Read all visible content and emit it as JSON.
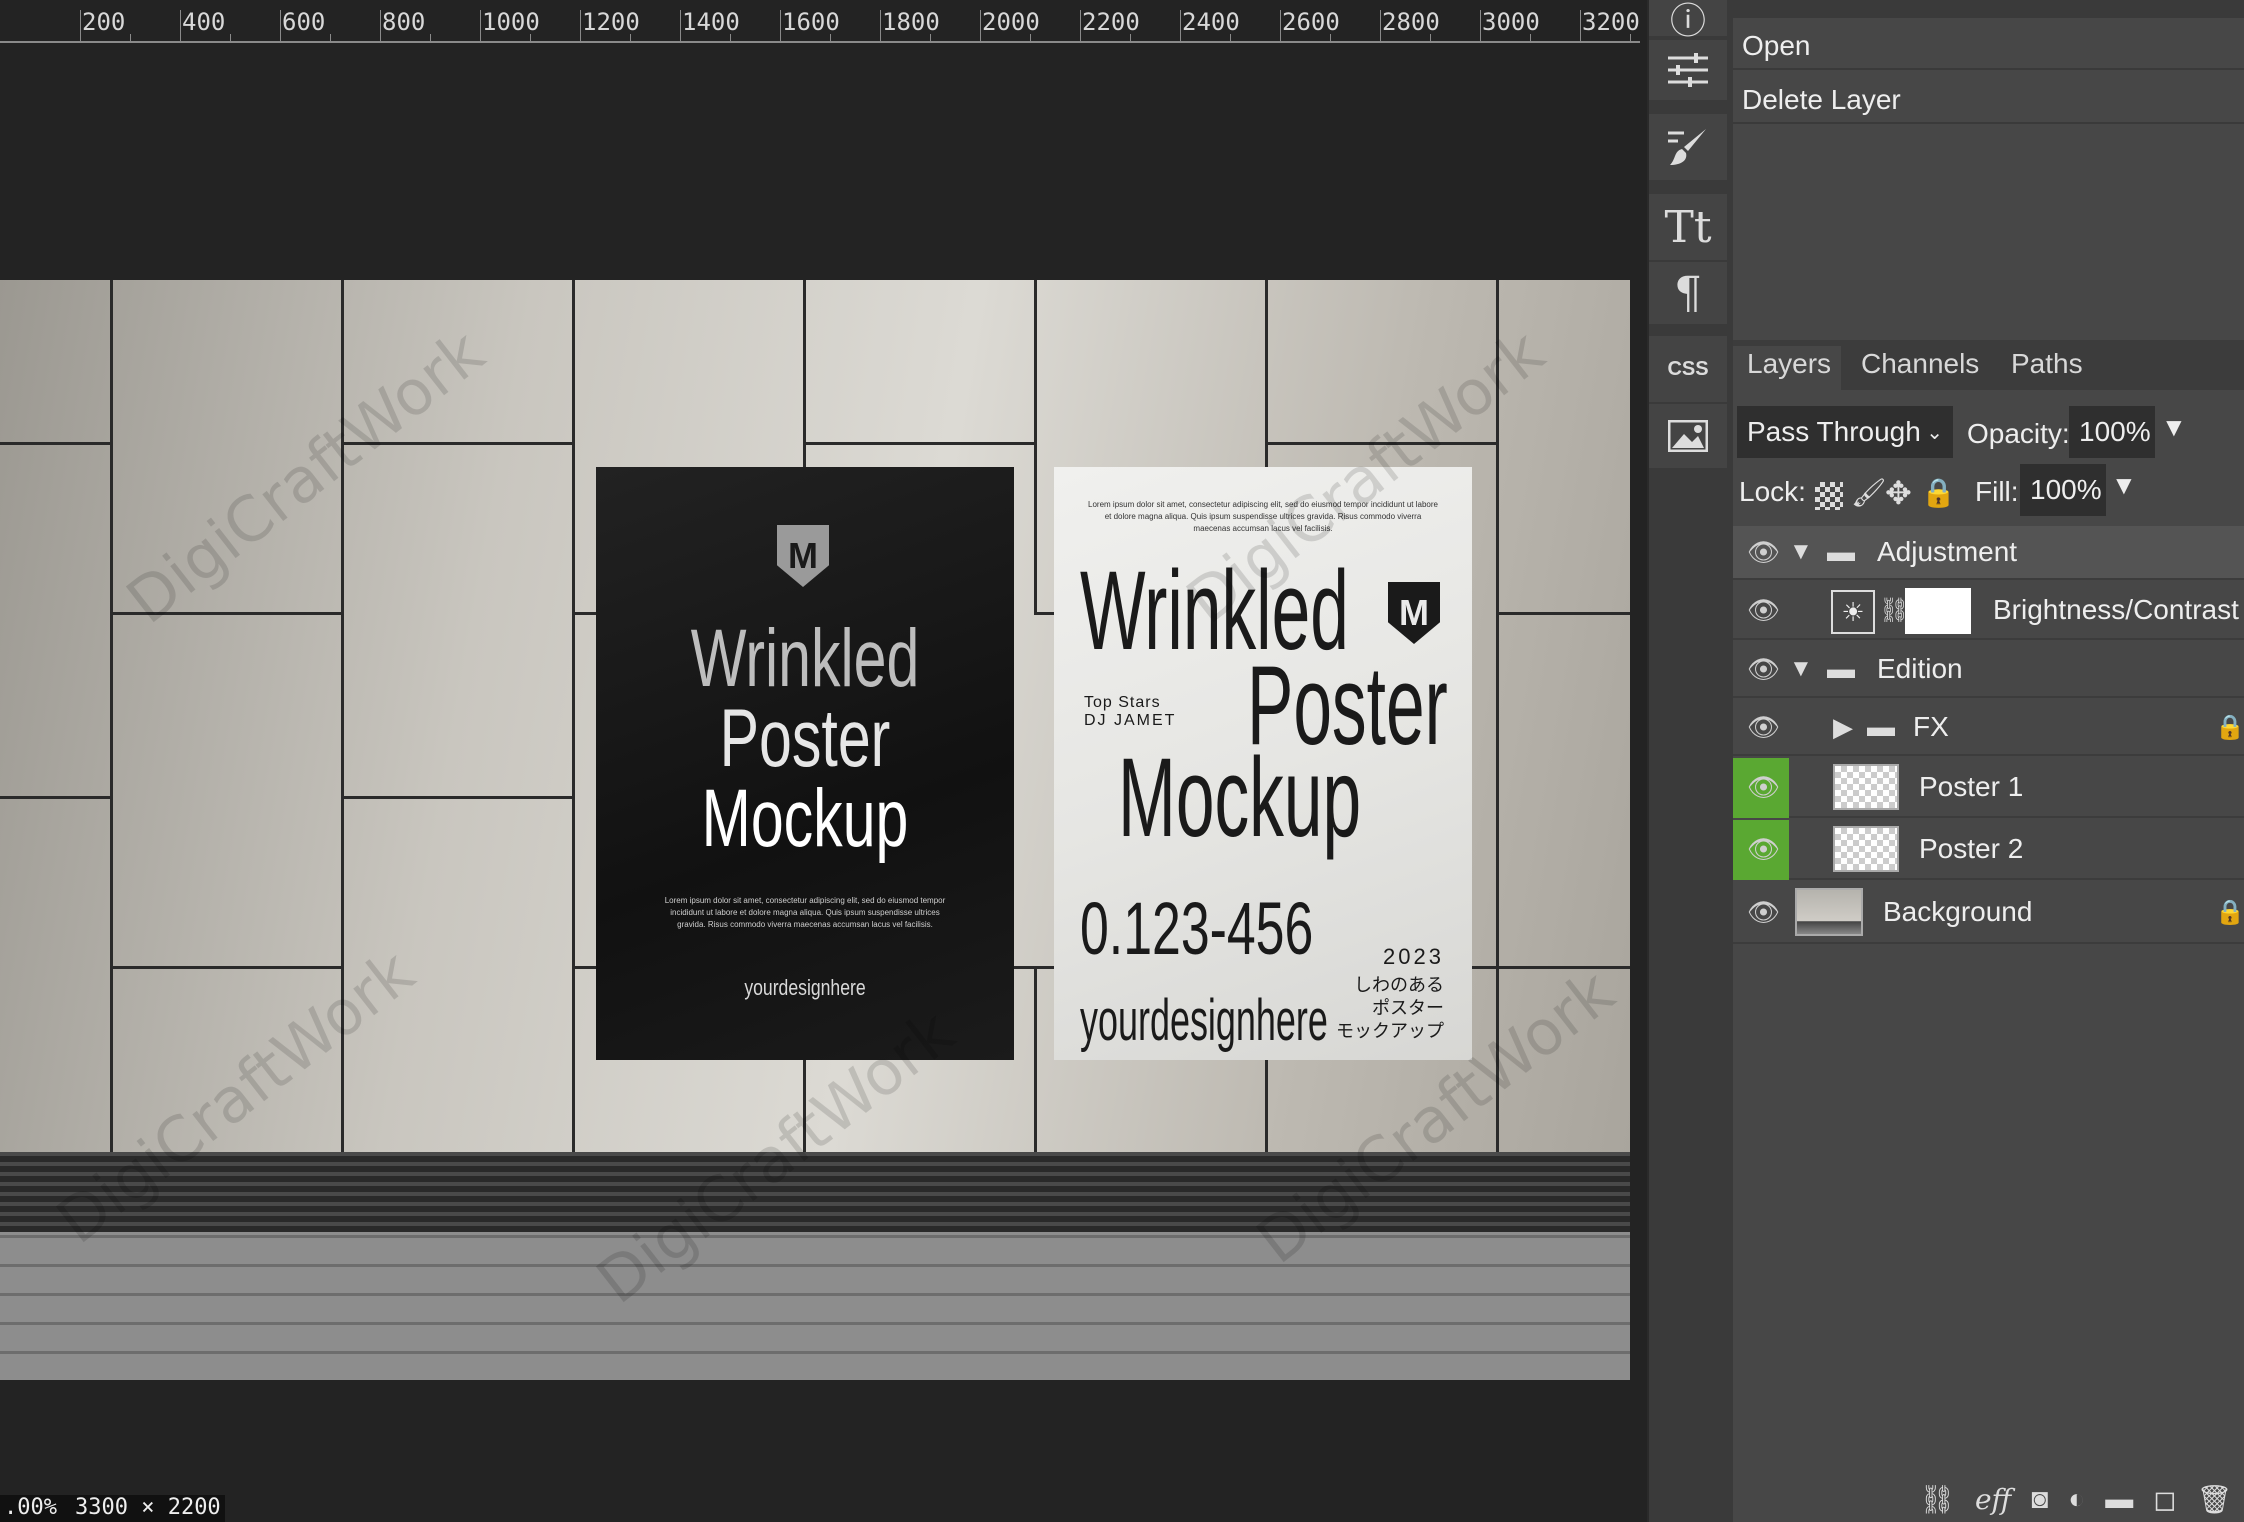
{
  "ruler": {
    "labels": [
      "200",
      "400",
      "600",
      "800",
      "1000",
      "1200",
      "1400",
      "1600",
      "1800",
      "2000",
      "2200",
      "2400",
      "2600",
      "2800",
      "3000",
      "3200"
    ]
  },
  "watermark": "DigiCraftWork",
  "poster1": {
    "title_l1": "Wrinkled",
    "title_l2": "Poster",
    "title_l3": "Mockup",
    "lorem": "Lorem ipsum dolor sit amet, consectetur adipiscing elit, sed do eiusmod tempor incididunt ut labore et dolore magna aliqua. Quis ipsum suspendisse ultrices gravida. Risus commodo viverra maecenas accumsan lacus vel facilisis.",
    "site": "yourdesignhere",
    "logo": "M"
  },
  "poster2": {
    "lorem": "Lorem ipsum dolor sit amet, consectetur adipiscing elit, sed do eiusmod tempor incididunt ut labore et dolore magna aliqua. Quis ipsum suspendisse ultrices gravida. Risus commodo viverra maecenas accumsan lacus vel facilisis.",
    "title_l1": "Wrinkled",
    "title_l2": "Poster",
    "title_l3": "Mockup",
    "top_stars": "Top Stars",
    "dj": "DJ JAMET",
    "phone": "0.123-456",
    "year": "2023",
    "jp1": "しわのある",
    "jp2": "ポスター",
    "jp3": "モックアップ",
    "site": "yourdesignhere",
    "logo": "M"
  },
  "toolbar": {
    "icons": [
      "info-icon",
      "adjustments-icon",
      "brush-icon",
      "text-icon",
      "paragraph-icon",
      "css-icon",
      "image-icon"
    ],
    "text_glyph": "Tt",
    "para_glyph": "¶",
    "css_label": "CSS"
  },
  "history": {
    "items": [
      "Open",
      "Delete Layer"
    ]
  },
  "layers_panel": {
    "tabs": [
      "Layers",
      "Channels",
      "Paths"
    ],
    "blend_mode": "Pass Through",
    "opacity_label": "Opacity:",
    "opacity_value": "100%",
    "lock_label": "Lock:",
    "fill_label": "Fill:",
    "fill_value": "100%",
    "layers": [
      {
        "name": "Adjustment",
        "type": "group"
      },
      {
        "name": "Brightness/Contrast",
        "type": "adjustment"
      },
      {
        "name": "Edition",
        "type": "group"
      },
      {
        "name": "FX",
        "type": "group-collapsed"
      },
      {
        "name": "Poster 1",
        "type": "smart"
      },
      {
        "name": "Poster 2",
        "type": "smart"
      },
      {
        "name": "Background",
        "type": "image"
      }
    ]
  },
  "status": {
    "zoom": ".00%",
    "dims": "3300 × 2200"
  },
  "colors": {
    "visible_green": "#5aa832"
  }
}
